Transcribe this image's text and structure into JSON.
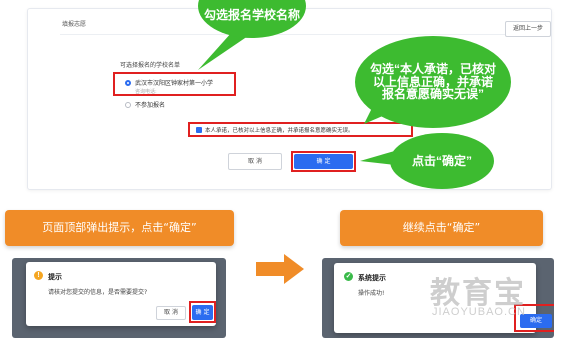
{
  "form": {
    "section_title": "填报志愿",
    "back_button": "返回上一步",
    "school_list_label": "可选择报名的学校名单",
    "school_option": "武汉市汉阳区钟家村第一小学",
    "school_phone": "咨询电话:",
    "no_apply_option": "不参加报名",
    "commitment_text": "本人承诺，已核对以上信息正确，并承诺报名意愿确实无误。",
    "cancel_button": "取 消",
    "confirm_button": "确 定"
  },
  "callouts": {
    "select_school": "勾选报名学校名称",
    "commit": "勾选“本人承诺，已核对以上信息正确，并承诺报名意愿确实无误”",
    "click_confirm": "点击“确定”"
  },
  "banners": {
    "step_left": "页面顶部弹出提示，点击“确定”",
    "step_right": "继续点击“确定”"
  },
  "dialog_confirm": {
    "icon_text": "!",
    "title": "提示",
    "message": "请核对您提交的信息，是否需要提交?",
    "cancel": "取 消",
    "confirm": "确 定"
  },
  "dialog_success": {
    "icon_text": "✓",
    "title": "系统提示",
    "message": "操作成功!",
    "confirm": "确定"
  },
  "watermark": {
    "cn": "教育宝",
    "en": "JIAOYUBAO.CN"
  },
  "colors": {
    "primary_blue": "#2b6cf0",
    "highlight_red": "#e02020",
    "callout_green": "#3dbb30",
    "banner_orange": "#f08c28"
  },
  "icons": {
    "warning": "warning-icon",
    "success": "check-circle-icon",
    "arrow": "right-arrow-icon"
  }
}
